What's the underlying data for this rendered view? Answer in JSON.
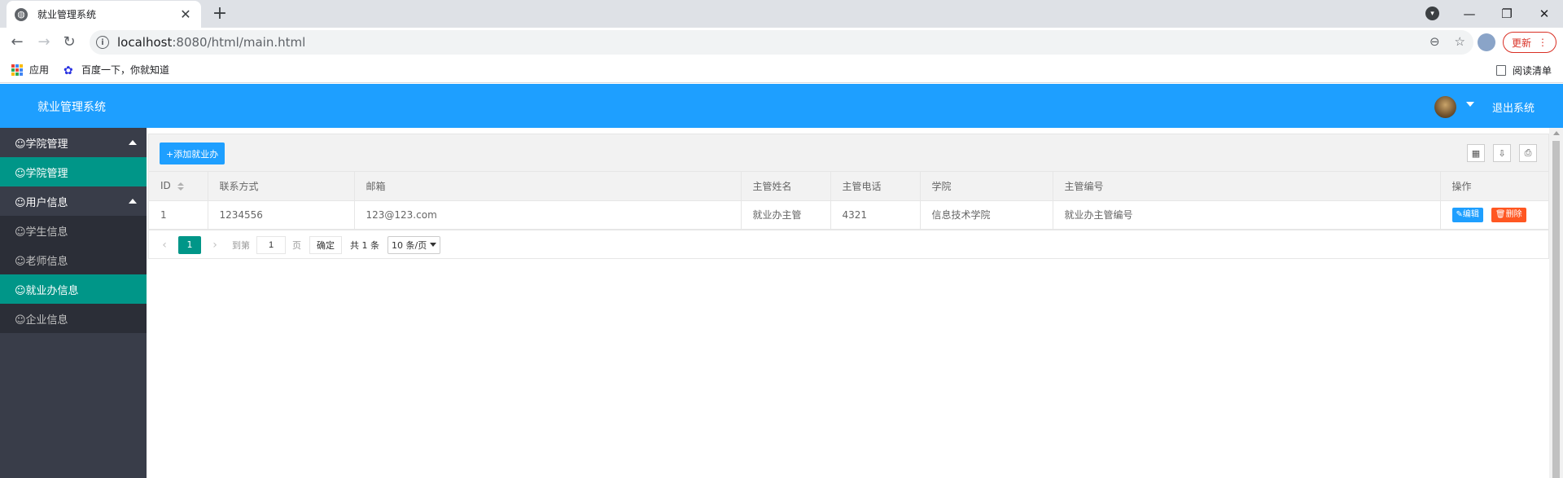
{
  "browser": {
    "tab_title": "就业管理系统",
    "new_tab": "+",
    "url_host": "localhost",
    "url_rest": ":8080/html/main.html",
    "update_label": "更新",
    "bookmarks": [
      {
        "label": "应用"
      },
      {
        "label": "百度一下，你就知道"
      }
    ],
    "reading_list": "阅读清单"
  },
  "header": {
    "title": "就业管理系统",
    "logout": "退出系统"
  },
  "sidebar": {
    "items": [
      {
        "label": "☺学院管理",
        "type": "group"
      },
      {
        "label": "☺学院管理",
        "type": "child-active"
      },
      {
        "label": "☺用户信息",
        "type": "group"
      },
      {
        "label": "☺学生信息",
        "type": "child"
      },
      {
        "label": "☺老师信息",
        "type": "child"
      },
      {
        "label": "☺就业办信息",
        "type": "child-active"
      },
      {
        "label": "☺企业信息",
        "type": "child"
      }
    ]
  },
  "toolbar": {
    "add_label": "+添加就业办"
  },
  "table": {
    "headers": [
      "ID",
      "联系方式",
      "邮箱",
      "主管姓名",
      "主管电话",
      "学院",
      "主管编号",
      "操作"
    ],
    "rows": [
      [
        "1",
        "1234556",
        "123@123.com",
        "就业办主管",
        "4321",
        "信息技术学院",
        "就业办主管编号"
      ]
    ],
    "edit_label": "✎编辑",
    "delete_label": "🗑删除"
  },
  "pager": {
    "current": "1",
    "goto_label": "到第",
    "page_value": "1",
    "page_suffix": "页",
    "confirm": "确定",
    "total": "共 1 条",
    "per_page": "10 条/页"
  },
  "colors": {
    "header_blue": "#1e9fff",
    "sidebar_bg": "#393d49",
    "active_green": "#009688",
    "delete_orange": "#ff5722"
  }
}
